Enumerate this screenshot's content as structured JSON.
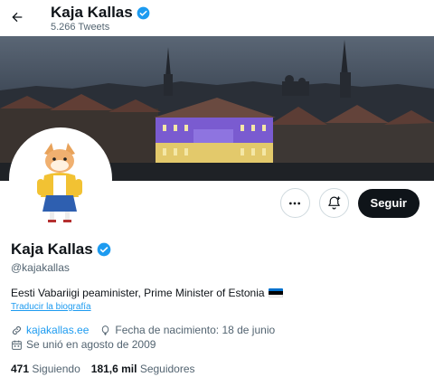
{
  "header": {
    "title": "Kaja Kallas",
    "tweets": "5.266 Tweets"
  },
  "profile": {
    "name": "Kaja Kallas",
    "handle": "@kajakallas",
    "bio": "Eesti Vabariigi peaminister, Prime Minister of Estonia",
    "translate_label": "Traducir la biografía",
    "website": "kajakallas.ee",
    "birthday": "Fecha de nacimiento: 18 de junio",
    "joined": "Se unió en agosto de 2009"
  },
  "actions": {
    "more_icon": "more-icon",
    "notify_icon": "bell-plus-icon",
    "follow_label": "Seguir"
  },
  "stats": {
    "following_count": "471",
    "following_label": "Siguiendo",
    "followers_count": "181,6 mil",
    "followers_label": "Seguidores"
  },
  "colors": {
    "accent": "#1d9bf0",
    "text": "#0f1419",
    "muted": "#536471",
    "verified": "#1d9bf0"
  }
}
